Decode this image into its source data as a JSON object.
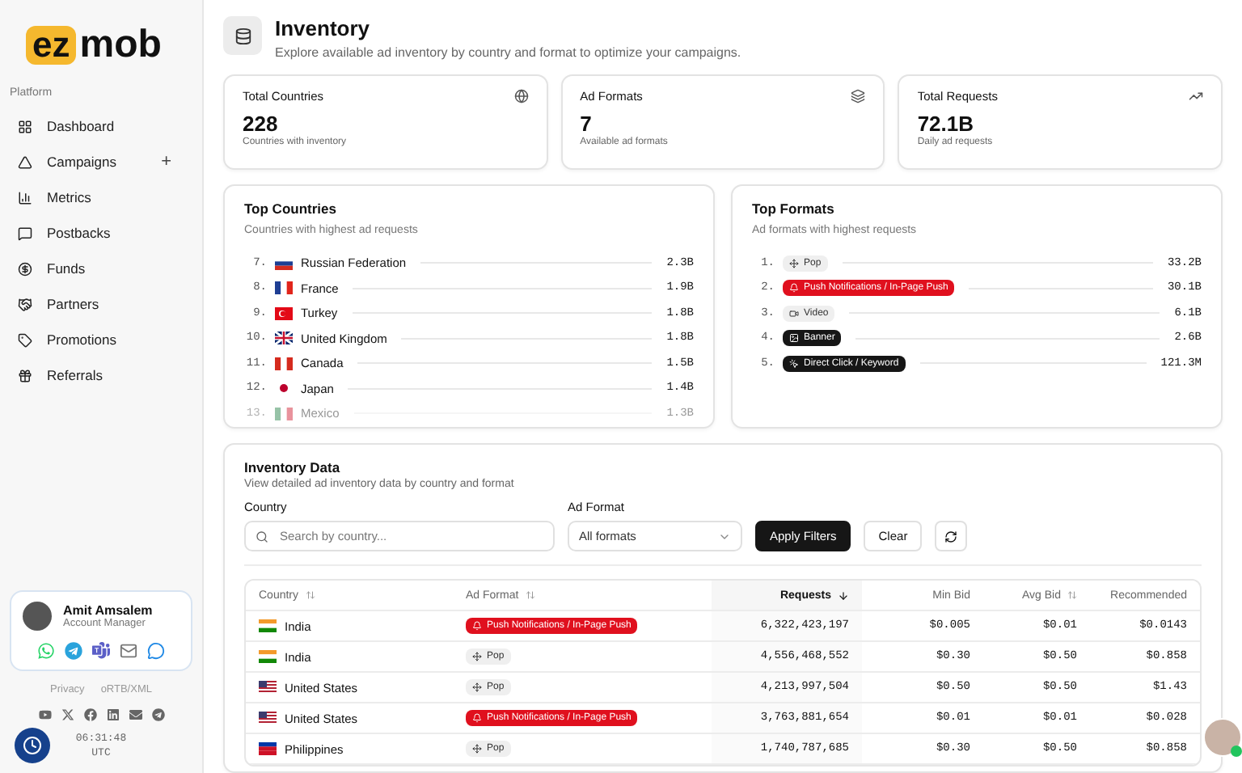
{
  "logo": {
    "badge": "ez",
    "text": "mob"
  },
  "sidebar": {
    "section": "Platform",
    "items": [
      {
        "label": "Dashboard"
      },
      {
        "label": "Campaigns",
        "action": "+"
      },
      {
        "label": "Metrics"
      },
      {
        "label": "Postbacks"
      },
      {
        "label": "Funds"
      },
      {
        "label": "Partners"
      },
      {
        "label": "Promotions"
      },
      {
        "label": "Referrals"
      }
    ],
    "manager": {
      "name": "Amit Amsalem",
      "role": "Account Manager"
    },
    "links": [
      "Privacy",
      "oRTB/XML"
    ],
    "clock": {
      "time": "06:31:48",
      "zone": "UTC"
    }
  },
  "header": {
    "title": "Inventory",
    "subtitle": "Explore available ad inventory by country and format to optimize your campaigns."
  },
  "stats": [
    {
      "label": "Total Countries",
      "value": "228",
      "caption": "Countries with inventory"
    },
    {
      "label": "Ad Formats",
      "value": "7",
      "caption": "Available ad formats"
    },
    {
      "label": "Total Requests",
      "value": "72.1B",
      "caption": "Daily ad requests"
    }
  ],
  "top_countries": {
    "title": "Top Countries",
    "subtitle": "Countries with highest ad requests",
    "rows": [
      {
        "rank": "7.",
        "name": "Russian Federation",
        "value": "2.3B"
      },
      {
        "rank": "8.",
        "name": "France",
        "value": "1.9B"
      },
      {
        "rank": "9.",
        "name": "Turkey",
        "value": "1.8B"
      },
      {
        "rank": "10.",
        "name": "United Kingdom",
        "value": "1.8B"
      },
      {
        "rank": "11.",
        "name": "Canada",
        "value": "1.5B"
      },
      {
        "rank": "12.",
        "name": "Japan",
        "value": "1.4B"
      },
      {
        "rank": "13.",
        "name": "Mexico",
        "value": "1.3B"
      }
    ]
  },
  "top_formats": {
    "title": "Top Formats",
    "subtitle": "Ad formats with highest requests",
    "rows": [
      {
        "rank": "1.",
        "kind": "pop",
        "name": "Pop",
        "value": "33.2B"
      },
      {
        "rank": "2.",
        "kind": "push",
        "name": "Push Notifications / In-Page Push",
        "value": "30.1B"
      },
      {
        "rank": "3.",
        "kind": "video",
        "name": "Video",
        "value": "6.1B"
      },
      {
        "rank": "4.",
        "kind": "banner",
        "name": "Banner",
        "value": "2.6B"
      },
      {
        "rank": "5.",
        "kind": "direct",
        "name": "Direct Click / Keyword",
        "value": "121.3M"
      }
    ]
  },
  "inventory": {
    "title": "Inventory Data",
    "subtitle": "View detailed ad inventory data by country and format",
    "filters": {
      "country_label": "Country",
      "country_placeholder": "Search by country...",
      "format_label": "Ad Format",
      "format_value": "All formats",
      "apply": "Apply Filters",
      "clear": "Clear"
    },
    "table": {
      "columns": [
        {
          "label": "Country",
          "sortable": true,
          "sorted": false
        },
        {
          "label": "Ad Format",
          "sortable": true,
          "sorted": false
        },
        {
          "label": "Requests",
          "sortable": true,
          "sorted": true
        },
        {
          "label": "Min Bid",
          "sortable": false,
          "sorted": false
        },
        {
          "label": "Avg Bid",
          "sortable": true,
          "sorted": false
        },
        {
          "label": "Recommended",
          "sortable": false,
          "sorted": false
        }
      ],
      "rows": [
        {
          "country": "India",
          "kind": "push",
          "format": "Push Notifications / In-Page Push",
          "requests": "6,322,423,197",
          "min_bid": "$0.005",
          "avg_bid": "$0.01",
          "recommended": "$0.0143"
        },
        {
          "country": "India",
          "kind": "pop",
          "format": "Pop",
          "requests": "4,556,468,552",
          "min_bid": "$0.30",
          "avg_bid": "$0.50",
          "recommended": "$0.858"
        },
        {
          "country": "United States",
          "kind": "pop",
          "format": "Pop",
          "requests": "4,213,997,504",
          "min_bid": "$0.50",
          "avg_bid": "$0.50",
          "recommended": "$1.43"
        },
        {
          "country": "United States",
          "kind": "push",
          "format": "Push Notifications / In-Page Push",
          "requests": "3,763,881,654",
          "min_bid": "$0.01",
          "avg_bid": "$0.01",
          "recommended": "$0.028"
        },
        {
          "country": "Philippines",
          "kind": "pop",
          "format": "Pop",
          "requests": "1,740,787,685",
          "min_bid": "$0.30",
          "avg_bid": "$0.50",
          "recommended": "$0.858"
        }
      ]
    }
  }
}
